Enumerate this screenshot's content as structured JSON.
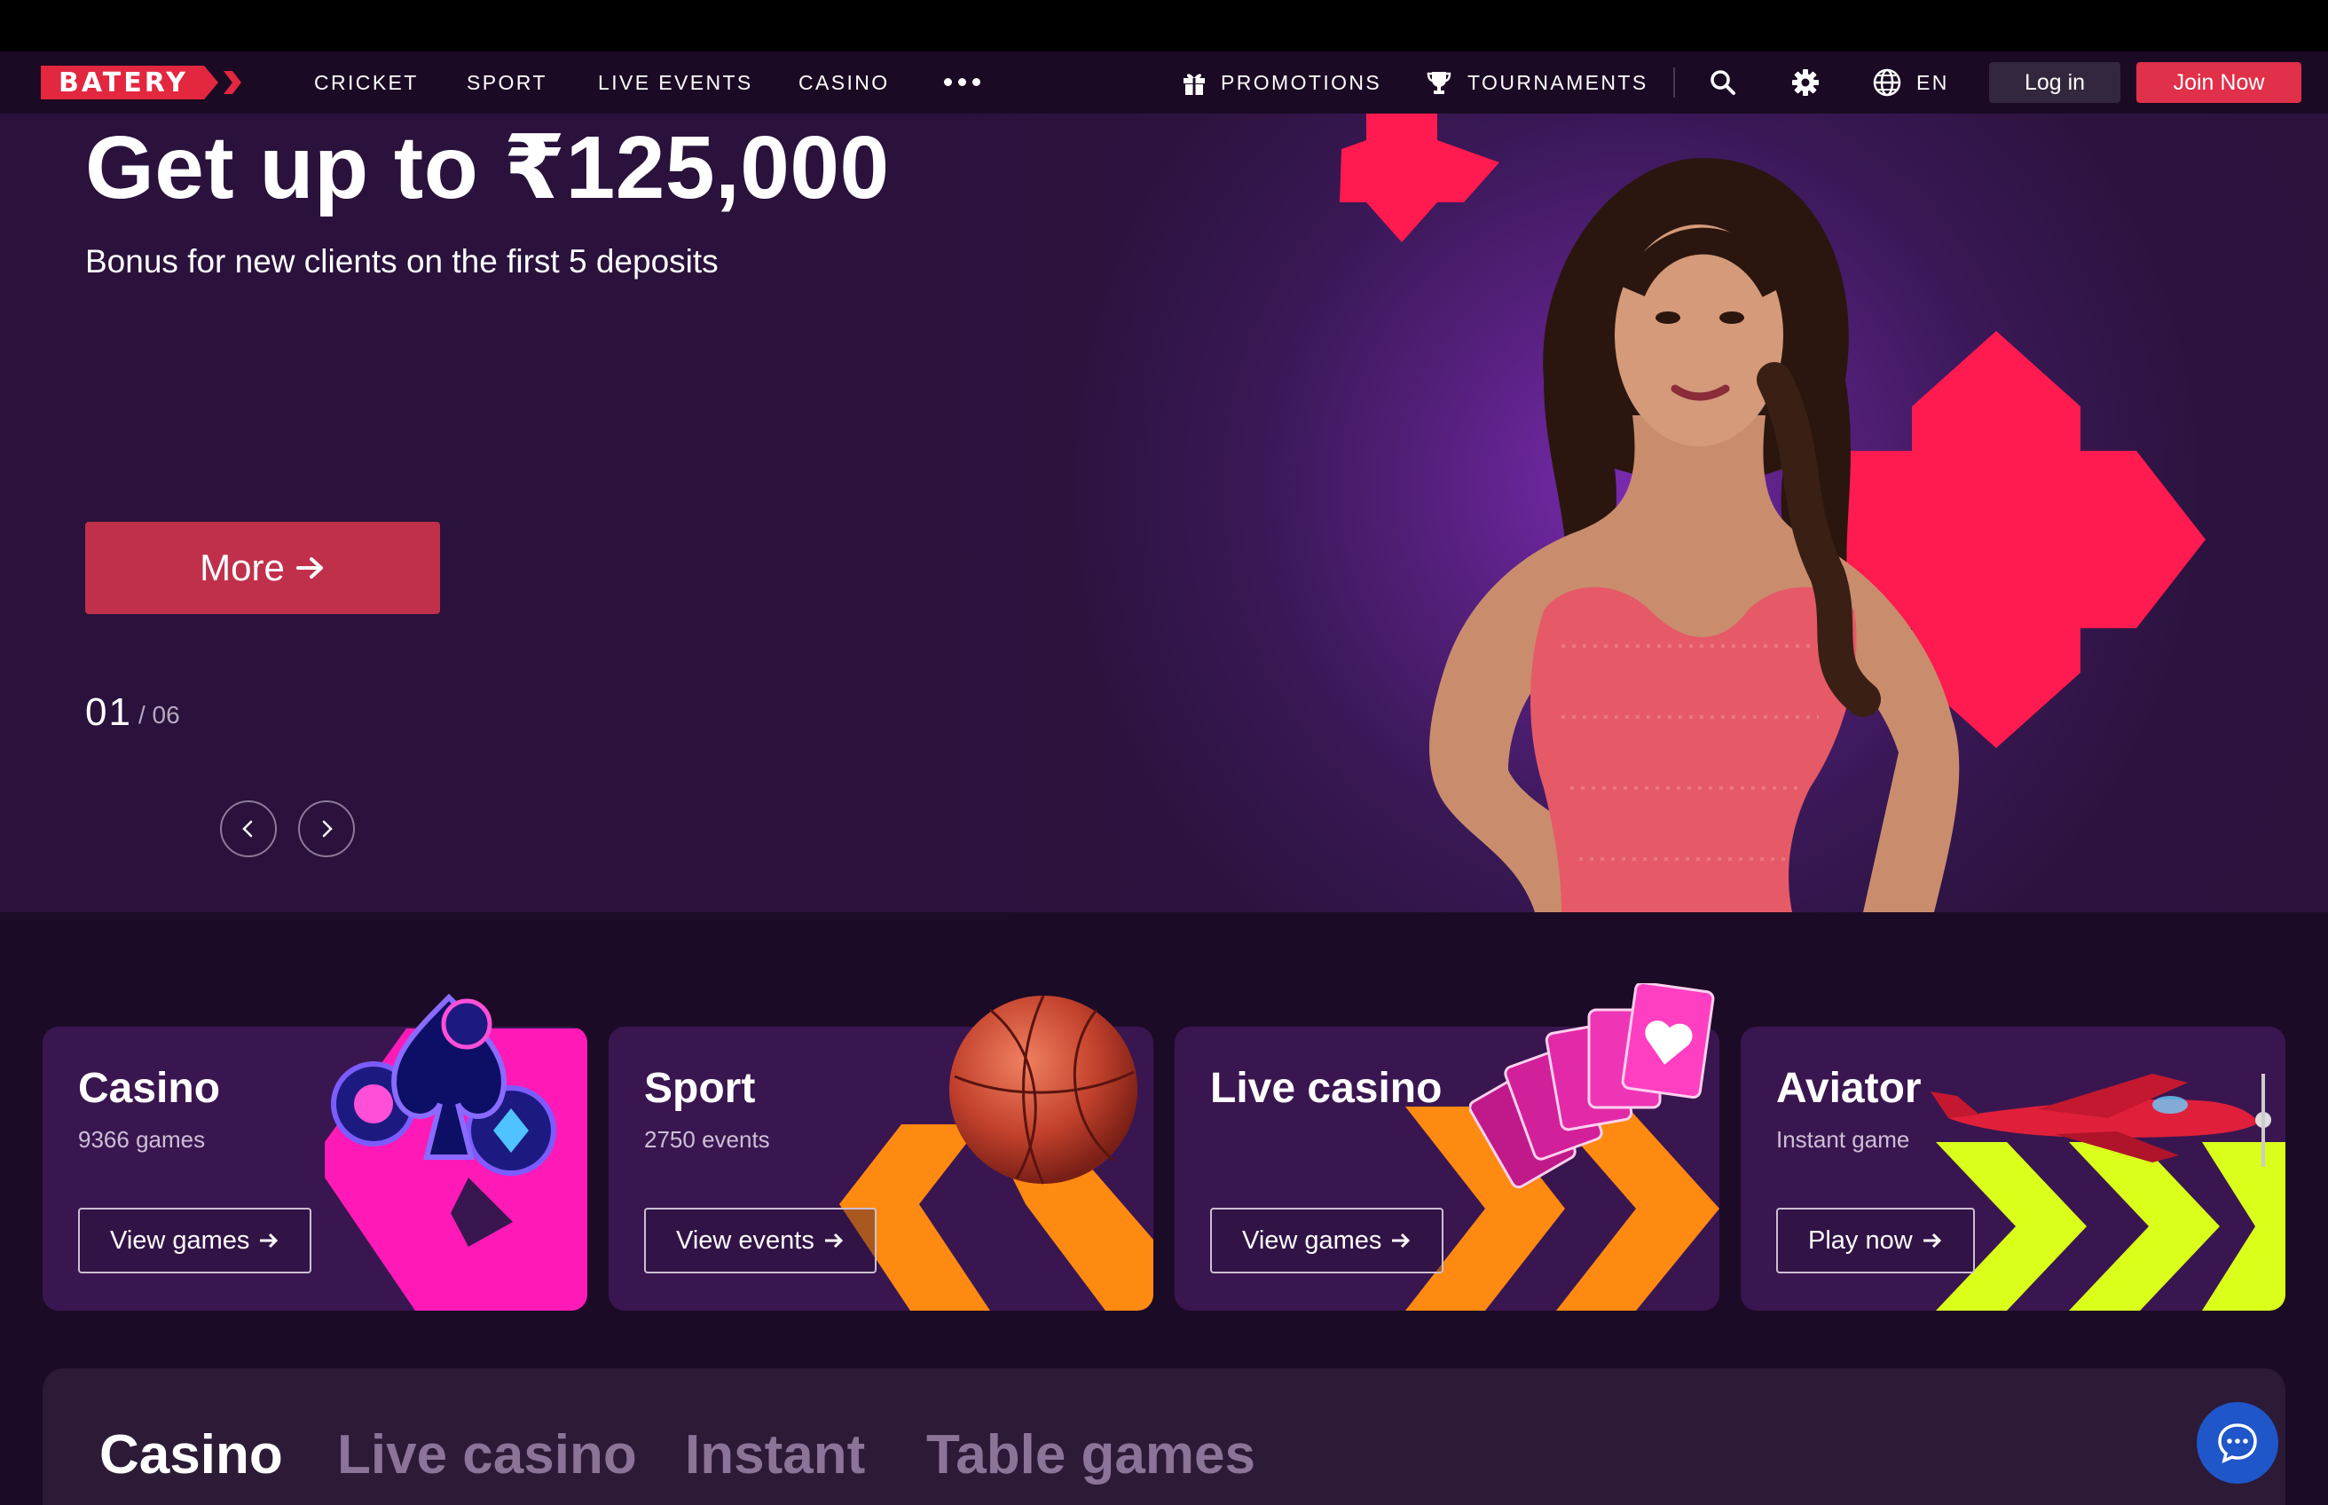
{
  "brand": {
    "logo_text": "BATERY",
    "accent": "#e2273f"
  },
  "nav": {
    "items": [
      "CRICKET",
      "SPORT",
      "LIVE EVENTS",
      "CASINO"
    ],
    "more_icon": "more-dots-icon",
    "promotions": "PROMOTIONS",
    "tournaments": "TOURNAMENTS",
    "language": "EN",
    "login": "Log in",
    "join": "Join Now"
  },
  "hero": {
    "title": "Get up to ₹125,000",
    "subtitle": "Bonus for new clients on the first 5 deposits",
    "cta": "More",
    "slide_current": "01",
    "slide_total": "/ 06"
  },
  "cards": [
    {
      "title": "Casino",
      "sub": "9366 games",
      "button": "View games"
    },
    {
      "title": "Sport",
      "sub": "2750 events",
      "button": "View events"
    },
    {
      "title": "Live casino",
      "sub": "",
      "button": "View games"
    },
    {
      "title": "Aviator",
      "sub": "Instant game",
      "button": "Play now"
    }
  ],
  "game_tabs": [
    "Casino",
    "Live casino",
    "Instant",
    "Table games"
  ],
  "colors": {
    "hero_bg": "#2a133c",
    "card_bg": "#3a1650",
    "join_btn": "#e0304a",
    "more_btn": "#c1304a",
    "chat_btn": "#1f56c9"
  }
}
